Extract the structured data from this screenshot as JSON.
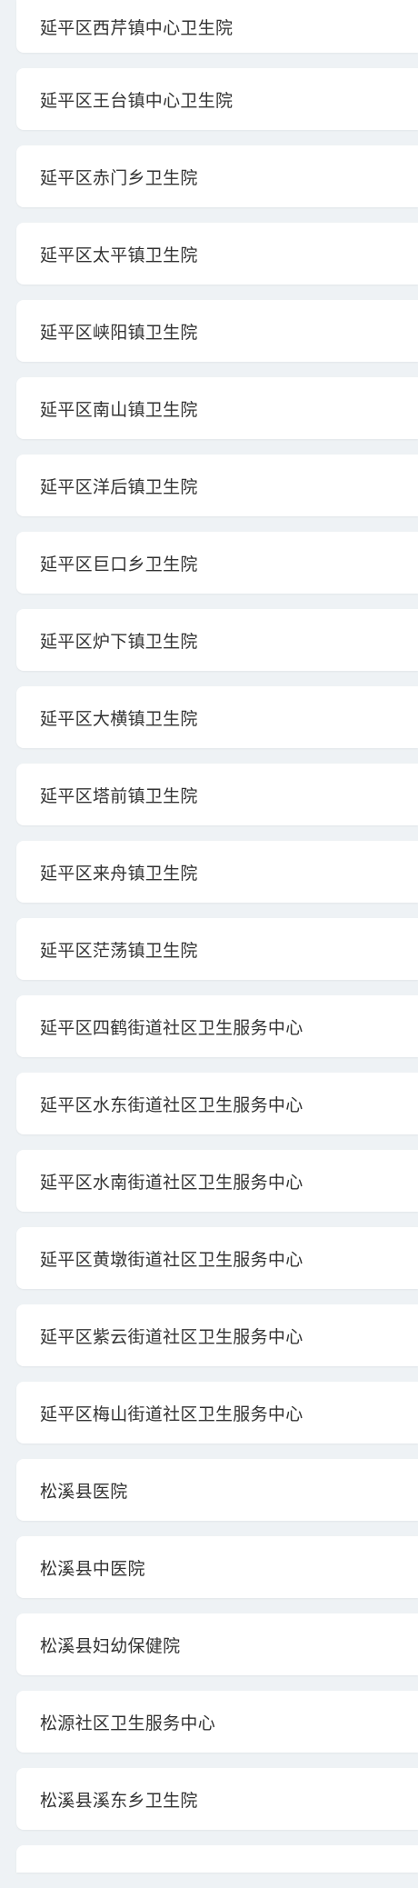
{
  "hospitals": [
    "延平区西芹镇中心卫生院",
    "延平区王台镇中心卫生院",
    "延平区赤门乡卫生院",
    "延平区太平镇卫生院",
    "延平区峡阳镇卫生院",
    "延平区南山镇卫生院",
    "延平区洋后镇卫生院",
    "延平区巨口乡卫生院",
    "延平区炉下镇卫生院",
    "延平区大横镇卫生院",
    "延平区塔前镇卫生院",
    "延平区来舟镇卫生院",
    "延平区茫荡镇卫生院",
    "延平区四鹤街道社区卫生服务中心",
    "延平区水东街道社区卫生服务中心",
    "延平区水南街道社区卫生服务中心",
    "延平区黄墩街道社区卫生服务中心",
    "延平区紫云街道社区卫生服务中心",
    "延平区梅山街道社区卫生服务中心",
    "松溪县医院",
    "松溪县中医院",
    "松溪县妇幼保健院",
    "松源社区卫生服务中心",
    "松溪县溪东乡卫生院"
  ]
}
